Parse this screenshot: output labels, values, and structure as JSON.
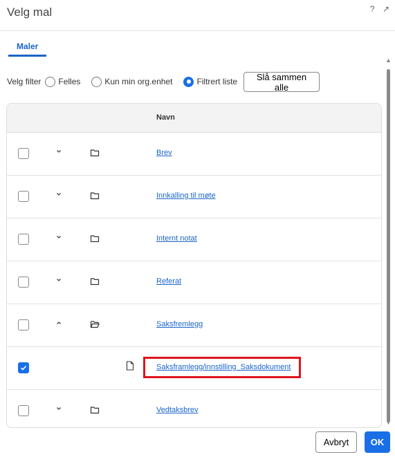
{
  "dialog": {
    "title": "Velg mal",
    "help_icon": "?",
    "expand_icon": "↗"
  },
  "tabs": [
    {
      "label": "Maler",
      "active": true
    }
  ],
  "filter": {
    "label": "Velg filter",
    "options": [
      {
        "label": "Felles",
        "selected": false
      },
      {
        "label": "Kun min org.enhet",
        "selected": false
      },
      {
        "label": "Filtrert liste",
        "selected": true
      }
    ],
    "merge_button": "Slå sammen alle"
  },
  "table": {
    "columns": {
      "name": "Navn"
    },
    "rows": [
      {
        "name": "Brev",
        "type": "folder",
        "expanded": false,
        "checked": false
      },
      {
        "name": "Innkalling til møte",
        "type": "folder",
        "expanded": false,
        "checked": false
      },
      {
        "name": "Internt notat",
        "type": "folder",
        "expanded": false,
        "checked": false
      },
      {
        "name": "Referat",
        "type": "folder",
        "expanded": false,
        "checked": false
      },
      {
        "name": "Saksfremlegg",
        "type": "folder",
        "expanded": true,
        "checked": false
      },
      {
        "name": "Saksframlegg/innstilling_Saksdokument",
        "type": "file",
        "checked": true,
        "highlighted": true
      },
      {
        "name": "Vedtaksbrev",
        "type": "folder",
        "expanded": false,
        "checked": false
      }
    ]
  },
  "footer": {
    "cancel": "Avbryt",
    "ok": "OK"
  },
  "colors": {
    "accent": "#1a6fe6",
    "link": "#1a64c8",
    "highlight": "#e0141e"
  }
}
